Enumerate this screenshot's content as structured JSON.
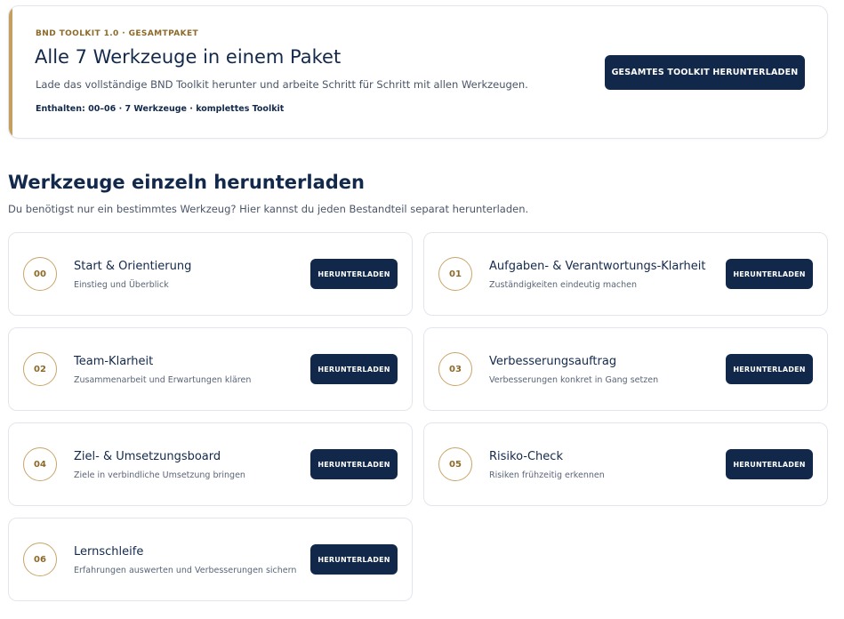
{
  "bundle": {
    "eyebrow": "BND TOOLKIT 1.0 · GESAMTPAKET",
    "title": "Alle 7 Werkzeuge in einem Paket",
    "description": "Lade das vollständige BND Toolkit herunter und arbeite Schritt für Schritt mit allen Werkzeugen.",
    "includes": "Enthalten: 00–06 · 7 Werkzeuge · komplettes Toolkit",
    "button_label": "GESAMTES TOOLKIT HERUNTERLADEN"
  },
  "section": {
    "title": "Werkzeuge einzeln herunterladen",
    "subtitle": "Du benötigst nur ein bestimmtes Werkzeug? Hier kannst du jeden Bestandteil separat herunterladen."
  },
  "download_label": "HERUNTERLADEN",
  "tools": [
    {
      "number": "00",
      "name": "Start & Orientierung",
      "description": "Einstieg und Überblick"
    },
    {
      "number": "01",
      "name": "Aufgaben- & Verantwortungs-Klarheit",
      "description": "Zuständigkeiten eindeutig machen"
    },
    {
      "number": "02",
      "name": "Team-Klarheit",
      "description": "Zusammenarbeit und Erwartungen klären"
    },
    {
      "number": "03",
      "name": "Verbesserungsauftrag",
      "description": "Verbesserungen konkret in Gang setzen"
    },
    {
      "number": "04",
      "name": "Ziel- & Umsetzungsboard",
      "description": "Ziele in verbindliche Umsetzung bringen"
    },
    {
      "number": "05",
      "name": "Risiko-Check",
      "description": "Risiken frühzeitig erkennen"
    },
    {
      "number": "06",
      "name": "Lernschleife",
      "description": "Erfahrungen auswerten und Verbesserungen sichern"
    }
  ],
  "colors": {
    "navy": "#12284a",
    "gold": "#c4a060",
    "gold_text": "#8d6a2a",
    "border": "#e2e6ec"
  }
}
